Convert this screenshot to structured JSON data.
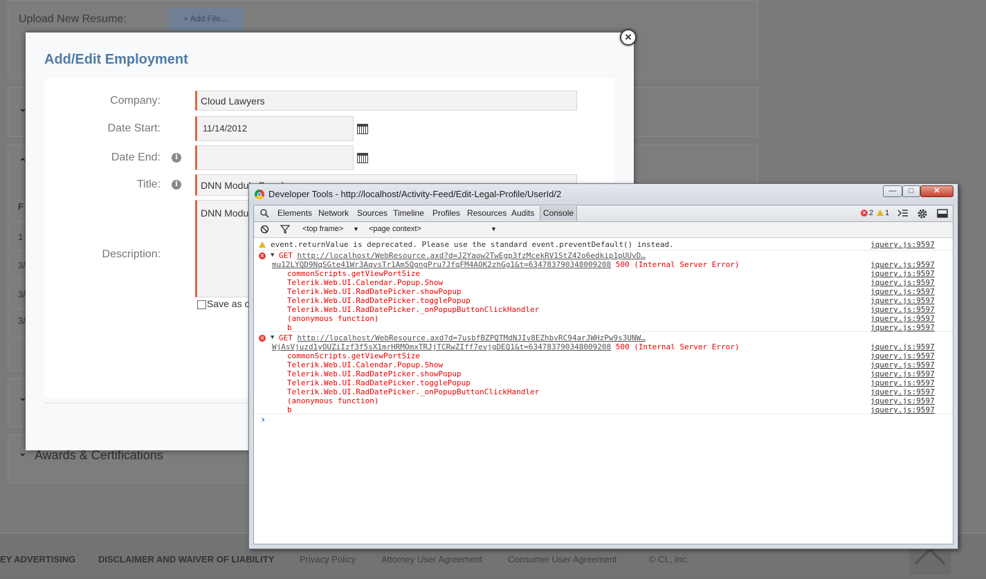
{
  "background": {
    "upload_label": "Upload New Resume:",
    "add_file_label": "+ Add File...",
    "table_header": "F",
    "row_snippets": [
      "1",
      "3/",
      "3/",
      "3/"
    ],
    "awards_label": "Awards & Certifications",
    "footer": {
      "advertising": "EY ADVERTISING",
      "disclaimer": "DISCLAIMER AND WAIVER OF LIABILITY",
      "privacy": "Privacy Policy",
      "attorney": "Attorney User Agreement",
      "consumer": "Consumer User Agreement",
      "copyright": "© CL, Inc."
    }
  },
  "modal": {
    "title": "Add/Edit Employment",
    "company_label": "Company:",
    "company_value": "Cloud Lawyers",
    "date_start_label": "Date Start:",
    "date_start_value": "11/14/2012",
    "date_end_label": "Date End:",
    "date_end_value": "",
    "title_label": "Title:",
    "title_value": "DNN Module Devel",
    "description_label": "Description:",
    "description_value": "DNN Modul",
    "save_as_label": "Save as c",
    "info_glyph": "i",
    "close_glyph": "×"
  },
  "devtools": {
    "window_title": "Developer Tools - http://localhost/Activity-Feed/Edit-Legal-Profile/UserId/2",
    "window_buttons": {
      "minimize": "—",
      "maximize": "□",
      "close": "✕"
    },
    "tabs": [
      "Elements",
      "Network",
      "Sources",
      "Timeline",
      "Profiles",
      "Resources",
      "Audits",
      "Console"
    ],
    "active_tab": "Console",
    "error_count": "2",
    "warning_count": "1",
    "frame_select": "<top frame>",
    "context_select": "<page context>",
    "messages": {
      "warning": {
        "text": "event.returnValue is deprecated. Please use the standard event.preventDefault() instead.",
        "source": "jquery.js:9597"
      },
      "error1": {
        "prefix": "GET ",
        "url_line1": "http://localhost/WebResource.axd?d=J2Yaow2TwEgp3fzMcekRV1StZ42o6edkip1pUUvD…",
        "url_line2": "mu12LYQD9NqSGte41Wr3AqvsTr1Am5QgngPru7JfqFM4AOK2zhGg1&t=634783790348009208",
        "status": " 500 (Internal Server Error)",
        "source": "jquery.js:9597"
      },
      "error2": {
        "prefix": "GET ",
        "url_line1": "http://localhost/WebResource.axd?d=7usbfBZPQTMdNJIv8EZhbvRC94arJWHzPw9s3UNW…",
        "url_line2": "WjAsVjuzd1yOUZiIzf3f5sX1mrHRMOmxTRJjTCRwZIff7evjgDEQ1&t=634783790348009208",
        "status": " 500 (Internal Server Error)",
        "source": "jquery.js:9597"
      },
      "stack": [
        "commonScripts.getViewPortSize",
        "Telerik.Web.UI.Calendar.Popup.Show",
        "Telerik.Web.UI.RadDatePicker.showPopup",
        "Telerik.Web.UI.RadDatePicker.togglePopup",
        "Telerik.Web.UI.RadDatePicker._onPopupButtonClickHandler",
        "(anonymous function)",
        "b"
      ],
      "stack_source": "jquery.js:9597"
    },
    "prompt": "›"
  }
}
